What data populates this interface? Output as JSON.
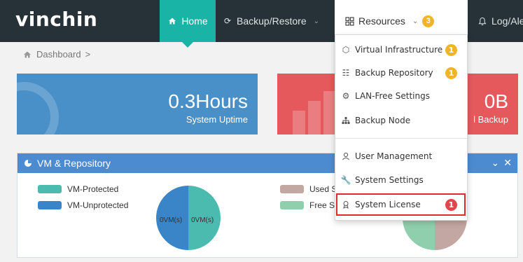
{
  "brand": "vinchin",
  "nav": {
    "home": "Home",
    "backup_restore": "Backup/Restore",
    "resources": "Resources",
    "resources_badge": "3",
    "log_alert": "Log/Alert"
  },
  "breadcrumb": {
    "item": "Dashboard",
    "sep": ">"
  },
  "cards": {
    "uptime_value": "0.3Hours",
    "uptime_label": "System Uptime",
    "backup_value": "0B",
    "backup_label": "l Backup"
  },
  "panel": {
    "title": "VM & Repository",
    "legend": {
      "vm_protected": "VM-Protected",
      "vm_unprotected": "VM-Unprotected",
      "used_space": "Used Spa",
      "free_space": "Free Spa"
    },
    "pie_left_label_a": "0VM(s)",
    "pie_left_label_b": "0VM(s)",
    "pie_right_label_a": "--",
    "pie_right_label_b": "--"
  },
  "dropdown": {
    "items": [
      {
        "label": "Virtual Infrastructure",
        "badge": "1"
      },
      {
        "label": "Backup Repository",
        "badge": "1"
      },
      {
        "label": "LAN-Free Settings"
      },
      {
        "label": "Backup Node"
      },
      {
        "label": "User Management"
      },
      {
        "label": "System Settings"
      },
      {
        "label": "System License",
        "badge": "1"
      }
    ]
  },
  "colors": {
    "nav_bg": "#263238",
    "home_active": "#19b4a6",
    "card_blue": "#4a90c8",
    "card_red": "#e5595c",
    "panel_header": "#4d8bd1",
    "vm_protected": "#4bbbb0",
    "vm_unprotected": "#3a85c7",
    "used_space": "#c2a7a2",
    "free_space": "#8fcfae",
    "badge_yellow": "#f0b429",
    "badge_red": "#e0474c"
  }
}
